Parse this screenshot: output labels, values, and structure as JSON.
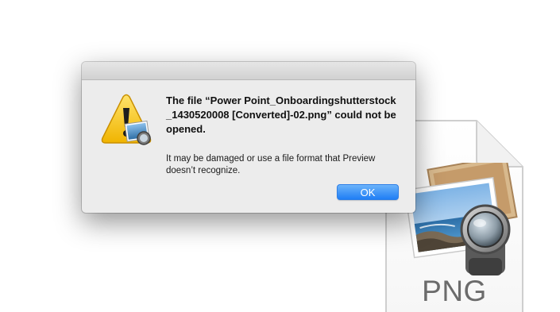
{
  "dialog": {
    "title": "The file “Power Point_Onboardingshutterstock_1430520008 [Converted]-02.png” could not be opened.",
    "message": "It may be damaged or use a file format that Preview doesn’t recognize.",
    "ok_label": "OK"
  },
  "file_icon": {
    "extension": "PNG"
  },
  "icons": {
    "alert": "warning-triangle-preview-icon",
    "file": "png-document-icon"
  },
  "colors": {
    "dialog_bg": "#ececec",
    "button_blue": "#1f7ef5",
    "warning_yellow": "#f5c400"
  }
}
